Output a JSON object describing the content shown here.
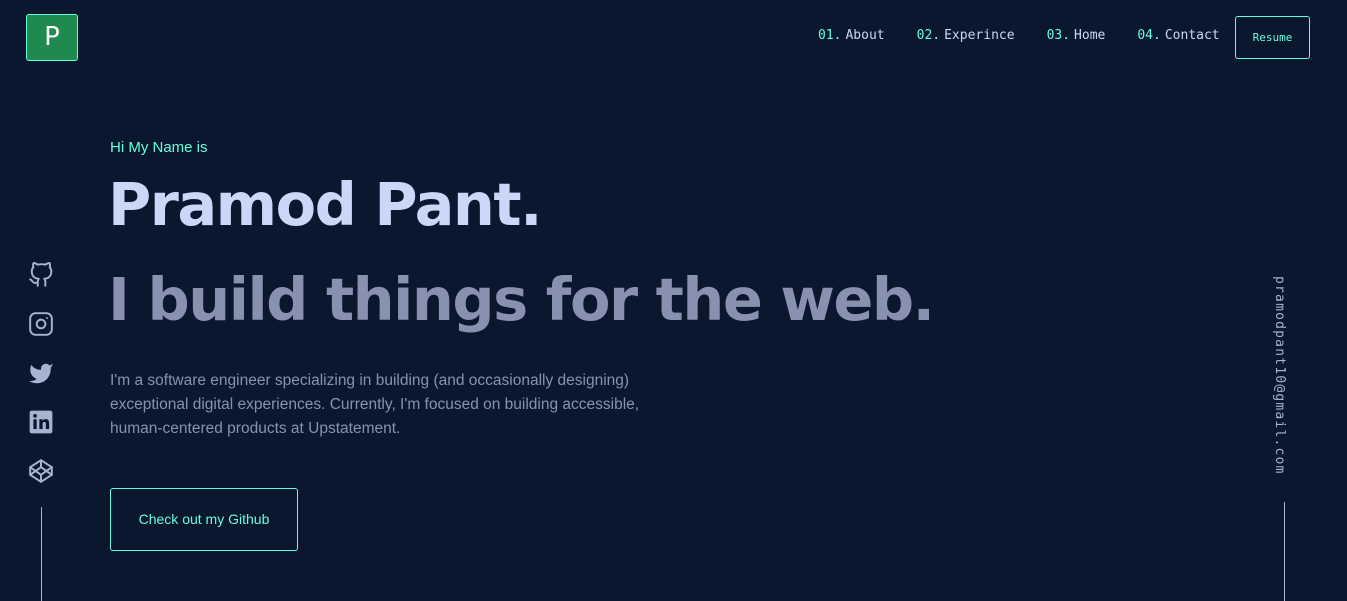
{
  "logo": {
    "letter": "P"
  },
  "nav": {
    "items": [
      {
        "num": "01.",
        "label": "About"
      },
      {
        "num": "02.",
        "label": "Experince"
      },
      {
        "num": "03.",
        "label": "Home"
      },
      {
        "num": "04.",
        "label": "Contact"
      }
    ],
    "resume_label": "Resume"
  },
  "hero": {
    "greeting": "Hi My Name is",
    "name": "Pramod Pant.",
    "tagline": "I build things for the web.",
    "bio": "I'm a software engineer specializing in building (and occasionally designing) exceptional digital experiences. Currently, I'm focused on building accessible, human-centered products at Upstatement.",
    "cta_label": "Check out my Github"
  },
  "socials": [
    "github-icon",
    "instagram-icon",
    "twitter-icon",
    "linkedin-icon",
    "codepen-icon"
  ],
  "email": "pramodpant10@gmail.com",
  "colors": {
    "background": "#0b172f",
    "accent": "#64ffda",
    "heading": "#ccd6f6",
    "muted": "#8892b0",
    "logo_bg": "#1e8a50"
  }
}
